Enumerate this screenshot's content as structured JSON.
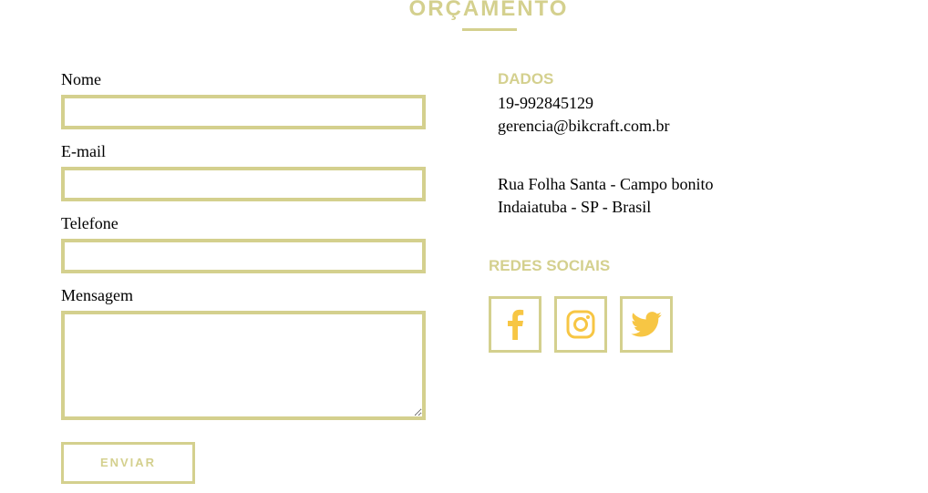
{
  "page": {
    "title": "ORÇAMENTO"
  },
  "form": {
    "name_label": "Nome",
    "email_label": "E-mail",
    "phone_label": "Telefone",
    "message_label": "Mensagem",
    "name_value": "",
    "email_value": "",
    "phone_value": "",
    "message_value": "",
    "submit_label": "ENVIAR"
  },
  "info": {
    "data_heading": "DADOS",
    "phone": "19-992845129",
    "email": "gerencia@bikcraft.com.br",
    "address_line1": "Rua Folha Santa - Campo bonito",
    "address_line2": "Indaiatuba - SP - Brasil",
    "social_heading": "REDES SOCIAIS"
  },
  "social": [
    {
      "icon": "facebook-icon"
    },
    {
      "icon": "instagram-icon"
    },
    {
      "icon": "twitter-icon"
    }
  ],
  "colors": {
    "accent": "#d4d08e",
    "icon": "#f7c644",
    "text": "#000000",
    "background": "#ffffff"
  }
}
